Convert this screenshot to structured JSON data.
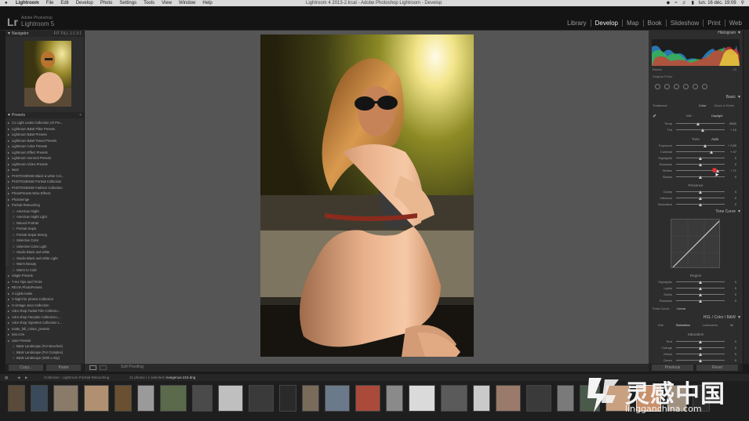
{
  "mac_menu": {
    "app": "Lightroom",
    "items": [
      "File",
      "Edit",
      "Develop",
      "Photo",
      "Settings",
      "Tools",
      "View",
      "Window",
      "Help"
    ],
    "document": "Lightroom 4 2013-2.lrcat - Adobe Photoshop Lightroom - Develop",
    "clock": "lun. 16 déc. 19:09",
    "status_icons": [
      "dropbox-icon",
      "wifi-icon",
      "volume-icon",
      "battery-icon",
      "spotlight-icon"
    ]
  },
  "identity": {
    "logo": "Lr",
    "brand_small": "Adobe Photoshop",
    "brand_name": "Lightroom 5"
  },
  "modules": [
    {
      "label": "Library",
      "active": false
    },
    {
      "label": "Develop",
      "active": true
    },
    {
      "label": "Map",
      "active": false
    },
    {
      "label": "Book",
      "active": false
    },
    {
      "label": "Slideshow",
      "active": false
    },
    {
      "label": "Print",
      "active": false
    },
    {
      "label": "Web",
      "active": false
    }
  ],
  "left": {
    "navigator_label": "Navigator",
    "navigator_zoom": "FIT  FILL  1:1  3:1",
    "presets_label": "Presets",
    "presets": [
      {
        "label": "C1 Light Leaks Collection LR Pre...",
        "child": false
      },
      {
        "label": "Lightroom B&W Filter Presets",
        "child": false
      },
      {
        "label": "Lightroom B&W Presets",
        "child": false
      },
      {
        "label": "Lightroom B&W Toned Presets",
        "child": false
      },
      {
        "label": "Lightroom Color Presets",
        "child": false
      },
      {
        "label": "Lightroom Effect Presets",
        "child": false
      },
      {
        "label": "Lightroom General Presets",
        "child": false
      },
      {
        "label": "Lightroom Video Presets",
        "child": false
      },
      {
        "label": "Nest",
        "child": false
      },
      {
        "label": "PHOTOSENSE Black & white Col...",
        "child": false
      },
      {
        "label": "PHOTOSENSE Portrait Collection",
        "child": false
      },
      {
        "label": "PHOTOSENSE Fashion Collection",
        "child": false
      },
      {
        "label": "PhotoPresets Wow Effects",
        "child": false
      },
      {
        "label": "Photosenge",
        "child": false
      },
      {
        "label": "Portrait Retouching",
        "child": false
      },
      {
        "label": "American Night",
        "child": true
      },
      {
        "label": "American Night Light",
        "child": true
      },
      {
        "label": "Natural Portrait",
        "child": true
      },
      {
        "label": "Portrait Sepia",
        "child": true
      },
      {
        "label": "Portrait Sepia Strong",
        "child": true
      },
      {
        "label": "Selective Color",
        "child": true
      },
      {
        "label": "Selective Color Light",
        "child": true
      },
      {
        "label": "Studio Black and white",
        "child": true
      },
      {
        "label": "Studio Black and white Light",
        "child": true
      },
      {
        "label": "Warm Beauty",
        "child": true
      },
      {
        "label": "Warm to Cold",
        "child": true
      },
      {
        "label": "Single Presets",
        "child": false
      },
      {
        "label": "T-rex Tips and Tricks",
        "child": false
      },
      {
        "label": "REVIA PhotoPresets",
        "child": false
      },
      {
        "label": "X Lights leaks",
        "child": false
      },
      {
        "label": "X Night for photos Collection",
        "child": false
      },
      {
        "label": "X-vintage Jean Collection",
        "child": false
      },
      {
        "label": "color shop Faded Film Collectio...",
        "child": false
      },
      {
        "label": "color shop Fairytale Collection L...",
        "child": false
      },
      {
        "label": "color shop Vignettes Collection L...",
        "child": false
      },
      {
        "label": "matte_fall_colour_presets",
        "child": false
      },
      {
        "label": "tuto.com",
        "child": false
      },
      {
        "label": "User Presets",
        "child": false
      },
      {
        "label": "B&W Landscape (For Beaches)",
        "child": true
      },
      {
        "label": "B&W Landscape (For Complex)",
        "child": true
      },
      {
        "label": "B&W Landscape (With a Sky)",
        "child": true
      }
    ],
    "copy_label": "Copy...",
    "paste_label": "Paste"
  },
  "toolbar": {
    "softproof_label": "Soft Proofing"
  },
  "right": {
    "histogram_label": "Histogram",
    "histo_text": "Blacks",
    "histo_value": "- 15",
    "original_label": "Original Photo",
    "basic_label": "Basic",
    "treatment_label": "Treatment :",
    "color_label": "Color",
    "bw_label": "Black & White",
    "wb_label": "WB :",
    "wb_value": "Daylight",
    "tone_label": "Tone",
    "auto_label": "Auto",
    "presence_label": "Presence",
    "sliders_wb": [
      {
        "label": "Temp",
        "value": "5500",
        "pos": 0.45
      },
      {
        "label": "Tint",
        "value": "+ 10",
        "pos": 0.55
      }
    ],
    "sliders_tone": [
      {
        "label": "Exposure",
        "value": "+ 0,50",
        "pos": 0.6
      },
      {
        "label": "Contrast",
        "value": "+ 47",
        "pos": 0.72
      },
      {
        "label": "Highlights",
        "value": "0",
        "pos": 0.5
      },
      {
        "label": "Shadows",
        "value": "0",
        "pos": 0.5
      },
      {
        "label": "Whites",
        "value": "+ 71",
        "pos": 0.86
      },
      {
        "label": "Blacks",
        "value": "0",
        "pos": 0.5
      }
    ],
    "sliders_presence": [
      {
        "label": "Clarity",
        "value": "0",
        "pos": 0.5
      },
      {
        "label": "Vibrance",
        "value": "0",
        "pos": 0.5
      },
      {
        "label": "Saturation",
        "value": "0",
        "pos": 0.5
      }
    ],
    "tonecurve_label": "Tone Curve",
    "region_label": "Region",
    "sliders_region": [
      {
        "label": "Highlights",
        "value": "0",
        "pos": 0.5
      },
      {
        "label": "Lights",
        "value": "0",
        "pos": 0.5
      },
      {
        "label": "Darks",
        "value": "0",
        "pos": 0.5
      },
      {
        "label": "Shadows",
        "value": "0",
        "pos": 0.5
      }
    ],
    "pointcurve_label": "Point Curve :",
    "pointcurve_value": "Linear",
    "hsl_label": "HSL / Color / B&W",
    "hsl_tabs": [
      "Hue",
      "Saturation",
      "Luminance",
      "All"
    ],
    "saturation_label": "Saturation",
    "sliders_hsl": [
      {
        "label": "Red",
        "value": "0",
        "pos": 0.5
      },
      {
        "label": "Orange",
        "value": "0",
        "pos": 0.5
      },
      {
        "label": "Yellow",
        "value": "0",
        "pos": 0.5
      },
      {
        "label": "Green",
        "value": "0",
        "pos": 0.5
      }
    ],
    "previous_label": "Previous",
    "reset_label": "Reset"
  },
  "filmstrip": {
    "collection": "Collection : Lightroom Portrait Retouching",
    "count": "21 photos / 1 selected /",
    "filename": "evegenus-215.dng",
    "selected_index": 23
  },
  "watermark": {
    "cn": "灵感中国",
    "en": "lingganchina.com"
  }
}
